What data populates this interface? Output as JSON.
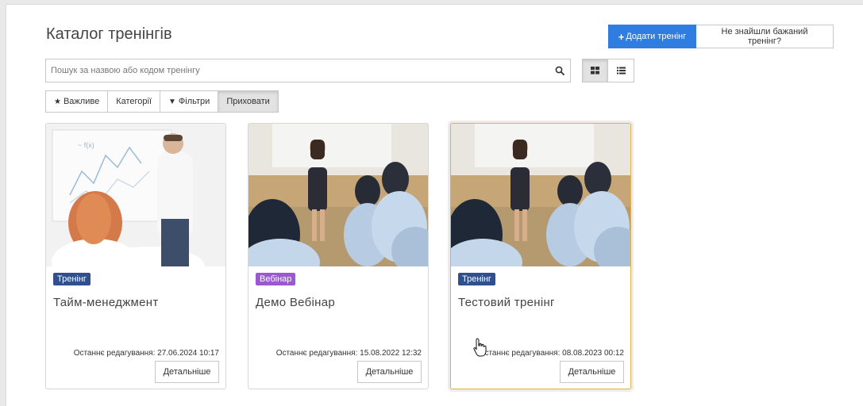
{
  "header": {
    "title": "Каталог тренінгів",
    "add_button": "Додати тренінг",
    "add_icon": "+",
    "missing_button": "Не знайшли бажаний тренінг?"
  },
  "search": {
    "placeholder": "Пошук за назвою або кодом тренінгу",
    "value": ""
  },
  "view_modes": [
    {
      "icon": "grid-icon",
      "active": true
    },
    {
      "icon": "list-icon",
      "active": false
    }
  ],
  "filters": [
    {
      "icon": "★",
      "label": "Важливе"
    },
    {
      "icon": "",
      "label": "Категорії"
    },
    {
      "icon": "▼",
      "label": "Фільтри"
    },
    {
      "icon": "",
      "label": "Приховати",
      "active": true
    }
  ],
  "cards": [
    {
      "badge": "Тренінг",
      "badge_color": "#2f4f8f",
      "title": "Тайм-менеджмент",
      "edited": "Останнє редагування: 27.06.2024 10:17",
      "details": "Детальніше"
    },
    {
      "badge": "Вебінар",
      "badge_color": "#9b59d0",
      "title": "Демо Вебінар",
      "edited": "Останнє редагування: 15.08.2022 12:32",
      "details": "Детальніше"
    },
    {
      "badge": "Тренінг",
      "badge_color": "#2f4f8f",
      "title": "Тестовий тренінг",
      "edited": "Останнє редагування: 08.08.2023 00:12",
      "details": "Детальніше"
    }
  ],
  "colors": {
    "primary": "#2f7de1",
    "highlight_border": "#e0b24a"
  }
}
